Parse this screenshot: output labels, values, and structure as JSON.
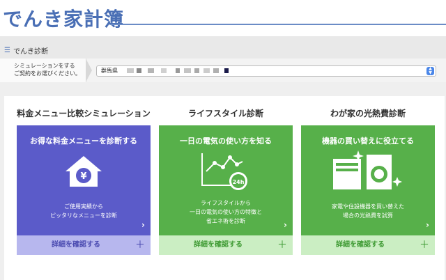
{
  "header": {
    "logo": "でんき家計簿"
  },
  "breadcrumb": {
    "label": "でんき診断"
  },
  "selector": {
    "label_line1": "シミュレーションをする",
    "label_line2": "ご契約をお選びください。",
    "value_prefix": "群馬県"
  },
  "columns": [
    {
      "title": "料金メニュー比較シミュレーション",
      "card_title": "お得な料金メニューを診断する",
      "desc_line1": "ご使用実績から",
      "desc_line2": "ピッタリなメニューを診断",
      "desc_line3": "",
      "icon": "house-yen-icon",
      "footer": "詳細を確認する"
    },
    {
      "title": "ライフスタイル診断",
      "card_title": "一日の電気の使い方を知る",
      "desc_line1": "ライフスタイルから",
      "desc_line2": "一日の電気の使い方の特徴と",
      "desc_line3": "省エネ術を診断",
      "icon": "line-chart-clock-icon",
      "icon_badge": "24h",
      "footer": "詳細を確認する"
    },
    {
      "title": "わが家の光熱費診断",
      "card_title": "機器の買い替えに役立てる",
      "desc_line1": "家電や住設機器を買い替えた",
      "desc_line2": "場合の光熱費を試算",
      "desc_line3": "",
      "icon": "appliances-icon",
      "footer": "詳細を確認する"
    }
  ],
  "colors": {
    "brand": "#4a6fb5",
    "card_purple": "#5b5bc9",
    "card_green": "#57b04a",
    "foot_purple": "#b7b7ee",
    "foot_green": "#cbeec3"
  }
}
